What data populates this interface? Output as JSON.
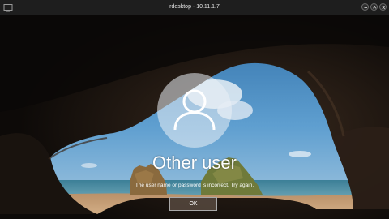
{
  "window": {
    "title": "rdesktop - 10.11.1.7",
    "controls": [
      "minimize",
      "maximize",
      "close"
    ]
  },
  "login": {
    "user_name": "Other user",
    "error_message": "The user name or password is incorrect. Try again.",
    "ok_label": "OK",
    "avatar_icon": "user-silhouette-icon"
  },
  "colors": {
    "titlebar": "#1e1e1e",
    "sky": "#4d8ec4",
    "sea": "#2f6e8a",
    "sand": "#c9a27a",
    "cave": "#1a1410"
  }
}
